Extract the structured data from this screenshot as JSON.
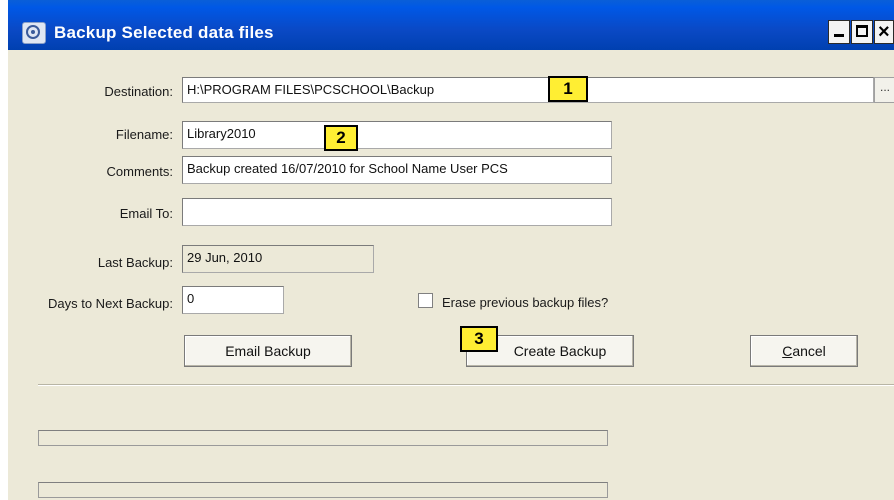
{
  "window": {
    "title": "Backup Selected data files",
    "minimize_glyph": "_",
    "close_glyph": "×"
  },
  "form": {
    "destination": {
      "label": "Destination:",
      "value": "H:\\PROGRAM FILES\\PCSCHOOL\\Backup",
      "browse_label": "..."
    },
    "filename": {
      "label": "Filename:",
      "value": "Library2010"
    },
    "comments": {
      "label": "Comments:",
      "value": "Backup  created 16/07/2010 for School Name User PCS"
    },
    "email_to": {
      "label": "Email To:",
      "value": ""
    },
    "last_backup": {
      "label": "Last Backup:",
      "value": "29 Jun, 2010"
    },
    "days_to_next": {
      "label": "Days to Next Backup:",
      "value": "0"
    },
    "erase_previous": {
      "label": "Erase previous backup files?",
      "checked": false
    }
  },
  "buttons": {
    "email_backup": "Email Backup",
    "create_backup": "Create Backup",
    "cancel_first": "C",
    "cancel_rest": "ancel"
  },
  "callouts": [
    "1",
    "2",
    "3"
  ],
  "colors": {
    "title_bar": "#0a49c5",
    "dialog_bg": "#ece9d8",
    "callout_bg": "#ffee33"
  }
}
